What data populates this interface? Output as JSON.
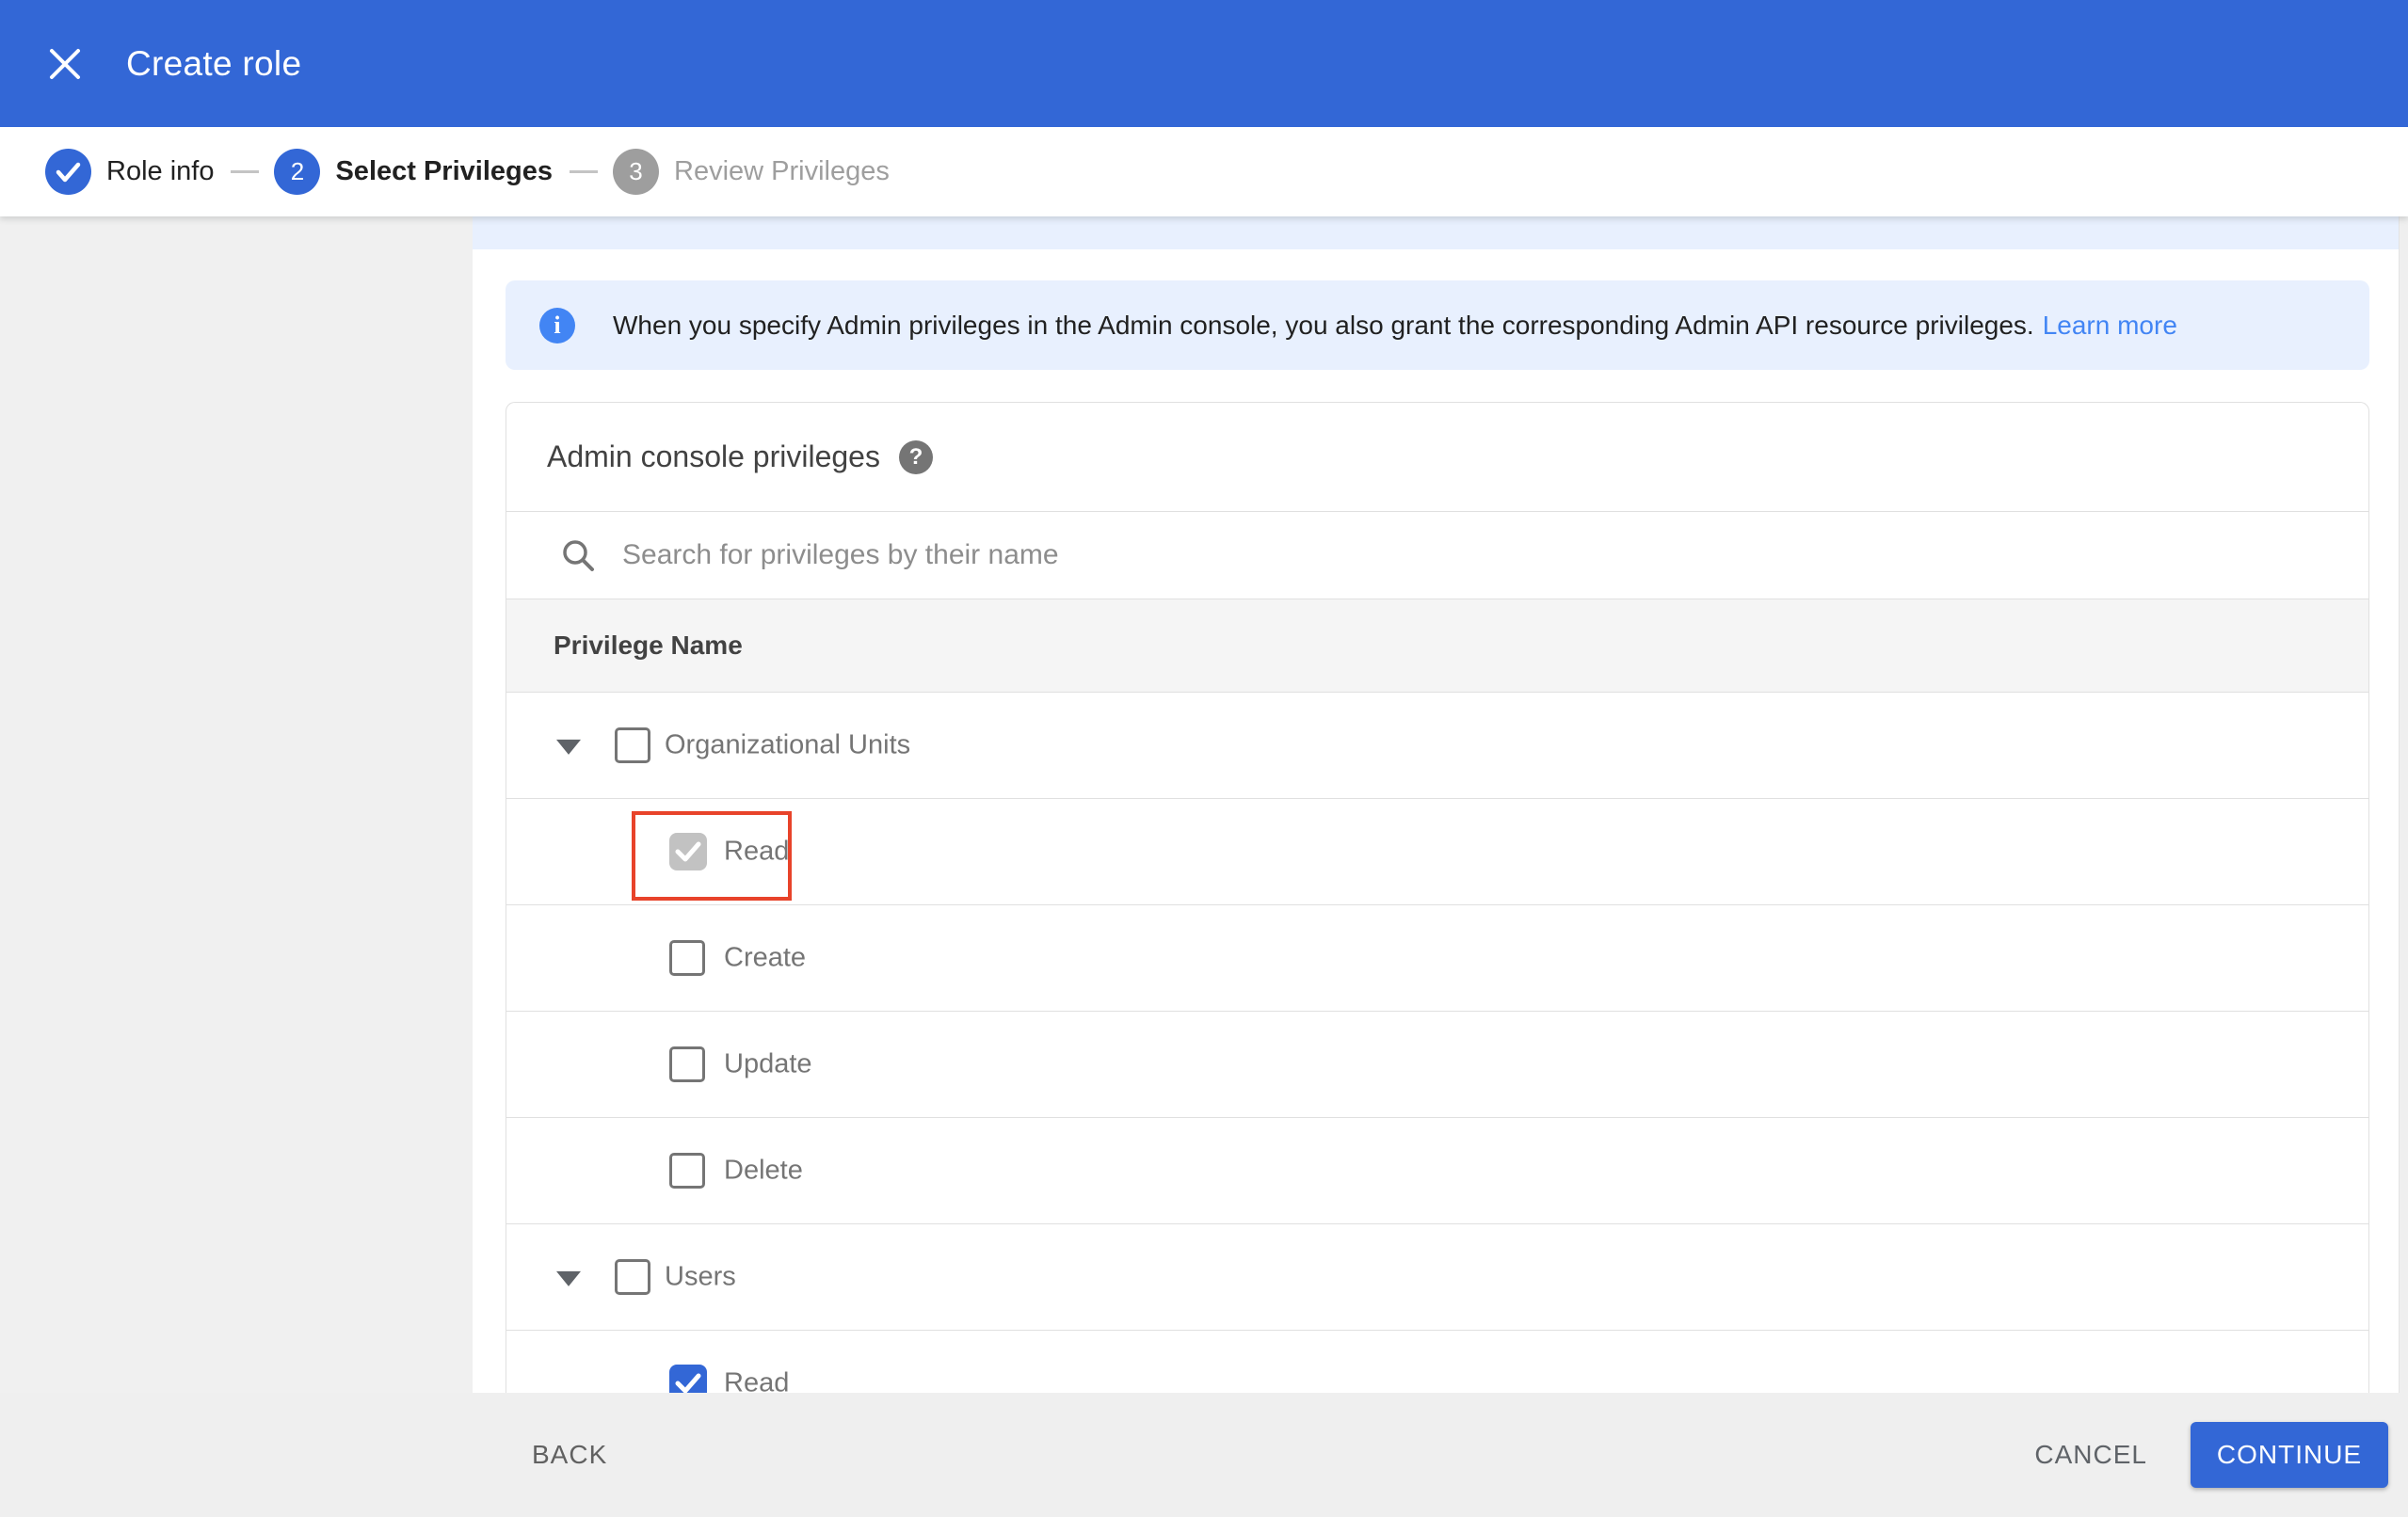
{
  "colors": {
    "header_blue": "#3367d6",
    "banner_bg": "#e8f0fe",
    "info_icon_blue": "#4285f4",
    "link_blue": "#4285f4",
    "checkbox_checked_blue": "#3367d6",
    "checkbox_checked_disabled_gray": "#c2c2c2",
    "annotation_red": "#e8432a",
    "inactive_step_gray": "#9e9e9e"
  },
  "header": {
    "title": "Create role"
  },
  "stepper": {
    "steps": [
      {
        "label": "Role info",
        "status": "completed"
      },
      {
        "number": "2",
        "label": "Select Privileges",
        "status": "active"
      },
      {
        "number": "3",
        "label": "Review Privileges",
        "status": "upcoming"
      }
    ]
  },
  "banner": {
    "text": "When you specify Admin privileges in the Admin console, you also grant the corresponding Admin API resource privileges.",
    "link_label": "Learn more"
  },
  "privileges_card": {
    "title": "Admin console privileges",
    "search_placeholder": "Search for privileges by their name",
    "column_header": "Privilege Name",
    "rows": [
      {
        "label": "Organizational Units",
        "level": 0,
        "expandable": true,
        "state": "unchecked"
      },
      {
        "label": "Read",
        "level": 1,
        "expandable": false,
        "state": "checked-disabled",
        "annotated": true
      },
      {
        "label": "Create",
        "level": 1,
        "expandable": false,
        "state": "unchecked"
      },
      {
        "label": "Update",
        "level": 1,
        "expandable": false,
        "state": "unchecked"
      },
      {
        "label": "Delete",
        "level": 1,
        "expandable": false,
        "state": "unchecked"
      },
      {
        "label": "Users",
        "level": 0,
        "expandable": true,
        "state": "unchecked"
      },
      {
        "label": "Read",
        "level": 1,
        "expandable": false,
        "state": "checked"
      }
    ]
  },
  "footer": {
    "back_label": "BACK",
    "cancel_label": "CANCEL",
    "continue_label": "CONTINUE"
  }
}
